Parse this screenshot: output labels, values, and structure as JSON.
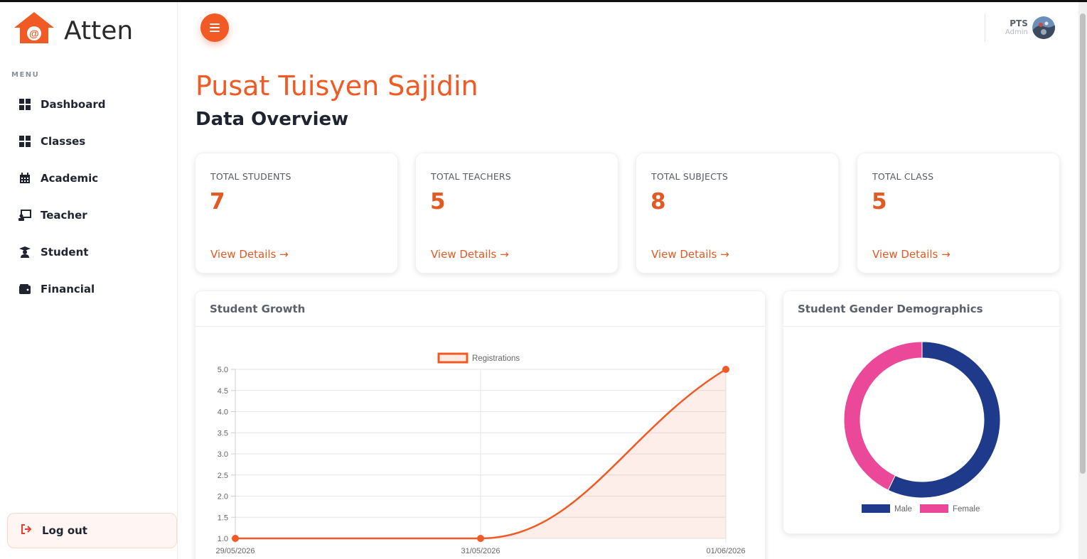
{
  "brand": {
    "name": "Atten",
    "logo_text": "@"
  },
  "sidebar": {
    "menu_heading": "MENU",
    "items": [
      {
        "label": "Dashboard",
        "icon": "dashboard-grid-icon"
      },
      {
        "label": "Classes",
        "icon": "grid-icon"
      },
      {
        "label": "Academic",
        "icon": "calendar-icon"
      },
      {
        "label": "Teacher",
        "icon": "teacher-board-icon"
      },
      {
        "label": "Student",
        "icon": "graduate-icon"
      },
      {
        "label": "Financial",
        "icon": "wallet-icon"
      }
    ],
    "logout_label": "Log out"
  },
  "topbar": {
    "user_name": "PTS",
    "user_role": "Admin"
  },
  "page": {
    "title": "Pusat Tuisyen Sajidin",
    "subtitle": "Data Overview"
  },
  "stats": [
    {
      "label": "TOTAL STUDENTS",
      "value": "7",
      "link": "View Details →"
    },
    {
      "label": "TOTAL TEACHERS",
      "value": "5",
      "link": "View Details →"
    },
    {
      "label": "TOTAL SUBJECTS",
      "value": "8",
      "link": "View Details →"
    },
    {
      "label": "TOTAL CLASS",
      "value": "5",
      "link": "View Details →"
    }
  ],
  "panels": {
    "growth_title": "Student Growth",
    "gender_title": "Student Gender Demographics"
  },
  "colors": {
    "accent": "#f15a24",
    "male": "#1f3a8a",
    "female": "#ec4899"
  },
  "chart_data": [
    {
      "type": "area",
      "title": "",
      "x": [
        "29/05/2026",
        "31/05/2026",
        "01/06/2026"
      ],
      "series": [
        {
          "name": "Registrations",
          "values": [
            1,
            1,
            5
          ]
        }
      ],
      "yticks": [
        "5.0",
        "4.5",
        "4.0",
        "3.5",
        "3.0",
        "2.5",
        "2.0",
        "1.5",
        "1.0"
      ],
      "ylim": [
        1,
        5
      ],
      "grid": true,
      "legend": "top-center"
    },
    {
      "type": "pie",
      "donut": true,
      "categories": [
        "Male",
        "Female"
      ],
      "values": [
        4,
        3
      ],
      "legend": "bottom"
    }
  ]
}
